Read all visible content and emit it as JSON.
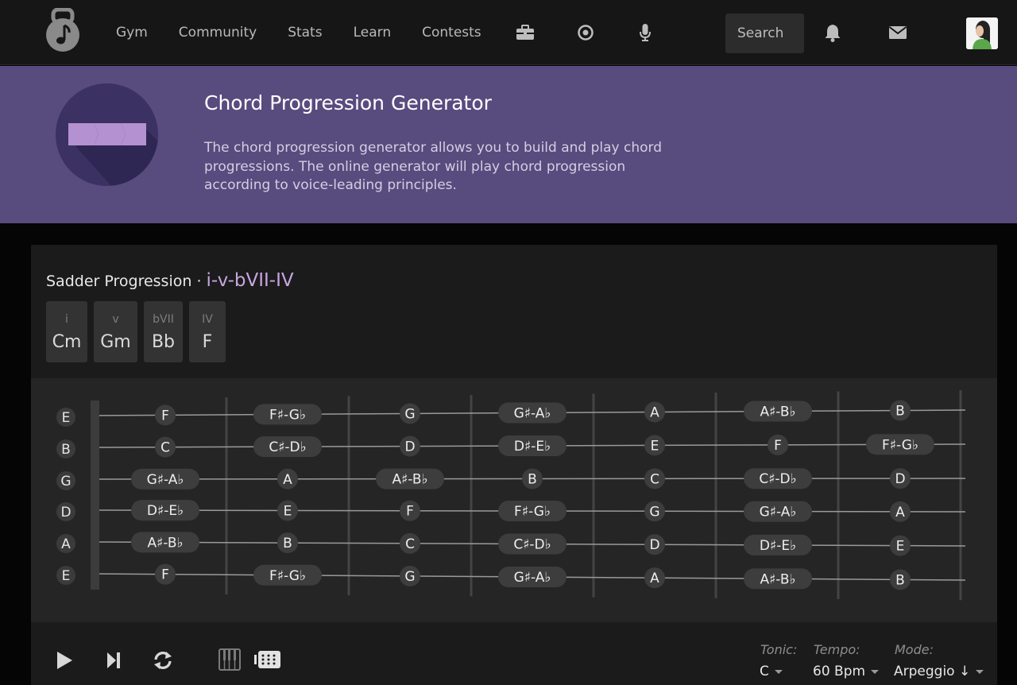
{
  "nav": {
    "links": [
      "Gym",
      "Community",
      "Stats",
      "Learn",
      "Contests"
    ],
    "icons": [
      "briefcase-icon",
      "target-icon",
      "microphone-icon"
    ],
    "search_placeholder": "Search",
    "right_icons": [
      "bell-icon",
      "envelope-icon"
    ]
  },
  "hero": {
    "title": "Chord Progression Generator",
    "description": "The chord progression generator allows you to build and play chord progressions. The online generator will play chord progression according to voice-leading principles."
  },
  "progression": {
    "name": "Sadder Progression",
    "separator": "·",
    "code": "i-v-bVII-IV",
    "chords": [
      {
        "degree": "i",
        "name": "Cm"
      },
      {
        "degree": "v",
        "name": "Gm"
      },
      {
        "degree": "bVII",
        "name": "Bb"
      },
      {
        "degree": "IV",
        "name": "F"
      }
    ]
  },
  "fretboard": {
    "strings": [
      "E",
      "B",
      "G",
      "D",
      "A",
      "E"
    ],
    "notes": [
      [
        "F",
        "F♯-G♭",
        "G",
        "G♯-A♭",
        "A",
        "A♯-B♭",
        "B"
      ],
      [
        "C",
        "C♯-D♭",
        "D",
        "D♯-E♭",
        "E",
        "F",
        "F♯-G♭"
      ],
      [
        "G♯-A♭",
        "A",
        "A♯-B♭",
        "B",
        "C",
        "C♯-D♭",
        "D"
      ],
      [
        "D♯-E♭",
        "E",
        "F",
        "F♯-G♭",
        "G",
        "G♯-A♭",
        "A"
      ],
      [
        "A♯-B♭",
        "B",
        "C",
        "C♯-D♭",
        "D",
        "D♯-E♭",
        "E"
      ],
      [
        "F",
        "F♯-G♭",
        "G",
        "G♯-A♭",
        "A",
        "A♯-B♭",
        "B"
      ]
    ]
  },
  "controls": {
    "buttons": [
      "play-icon",
      "skip-next-icon",
      "repeat-icon",
      "piano-icon",
      "guitar-fretboard-icon"
    ],
    "tonic": {
      "label": "Tonic:",
      "value": "C"
    },
    "tempo": {
      "label": "Tempo:",
      "value": "60 Bpm"
    },
    "mode": {
      "label": "Mode:",
      "value": "Arpeggio ↓"
    }
  },
  "colors": {
    "hero_bg": "#584b7e",
    "accent": "#c7a6e0",
    "nav_bg": "#161616",
    "card_bg": "#1b1b1b",
    "note_bg": "#3d3d3d"
  }
}
